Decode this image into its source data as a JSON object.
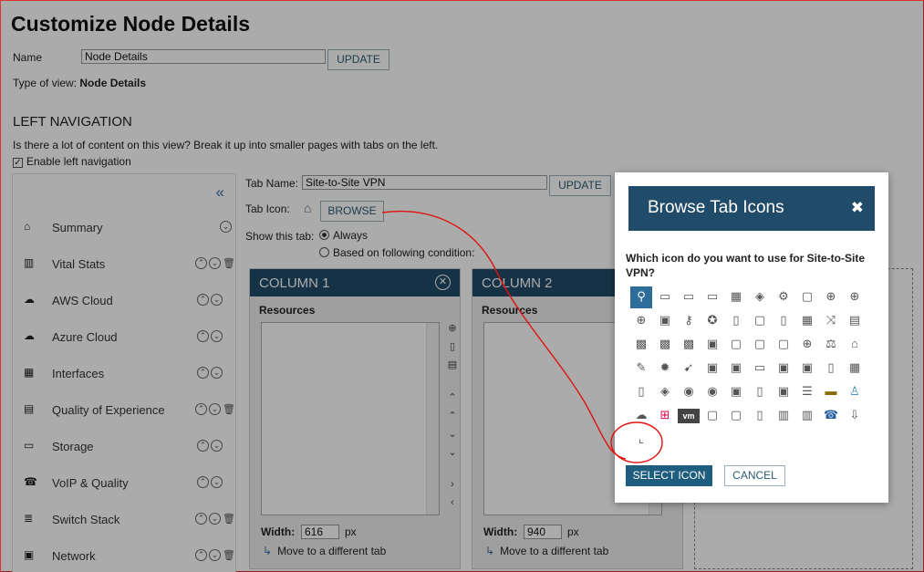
{
  "page": {
    "title": "Customize Node Details",
    "name_label": "Name",
    "name_value": "Node Details",
    "update_label": "UPDATE",
    "type_label": "Type of view:",
    "type_value": "Node Details"
  },
  "left_navigation": {
    "heading": "LEFT NAVIGATION",
    "question": "Is there a lot of content on this view? Break it up into smaller pages with tabs on the left.",
    "enable_label": "Enable left navigation",
    "collapse_glyph": "«",
    "items": [
      {
        "label": "Summary",
        "icon": "home-icon"
      },
      {
        "label": "Vital Stats",
        "icon": "chart-icon"
      },
      {
        "label": "AWS Cloud",
        "icon": "cloud-icon"
      },
      {
        "label": "Azure Cloud",
        "icon": "cloud-icon"
      },
      {
        "label": "Interfaces",
        "icon": "port-icon"
      },
      {
        "label": "Quality of Experience",
        "icon": "qoe-icon"
      },
      {
        "label": "Storage",
        "icon": "storage-icon"
      },
      {
        "label": "VoIP & Quality",
        "icon": "phone-icon"
      },
      {
        "label": "Switch Stack",
        "icon": "stack-icon"
      },
      {
        "label": "Network",
        "icon": "network-icon"
      }
    ]
  },
  "tab_editor": {
    "tab_name_label": "Tab Name:",
    "tab_name_value": "Site-to-Site VPN",
    "update_label": "UPDATE",
    "tab_icon_label": "Tab Icon:",
    "browse_label": "BROWSE",
    "show_label": "Show this tab:",
    "always_label": "Always",
    "condition_label": "Based on following condition:"
  },
  "columns": [
    {
      "title": "COLUMN 1",
      "resources_label": "Resources",
      "width_label": "Width:",
      "width_value": "616",
      "unit": "px",
      "move_label": "Move to a different tab"
    },
    {
      "title": "COLUMN 2",
      "resources_label": "Resources",
      "width_label": "Width:",
      "width_value": "940",
      "unit": "px",
      "move_label": "Move to a different tab"
    }
  ],
  "modal": {
    "title": "Browse Tab Icons",
    "close_glyph": "✖",
    "question": "Which icon do you want to use for Site-to-Site VPN?",
    "select_label": "SELECT ICON",
    "cancel_label": "CANCEL",
    "icons": [
      "vpn-icon",
      "window-icon",
      "window-icon",
      "window-icon",
      "port-icon",
      "layers-icon",
      "device-gear-icon",
      "device-icon",
      "globe-gear-icon",
      "globe-gear-icon",
      "globe-gear-icon",
      "monitor-icon",
      "key-icon",
      "hub-icon",
      "server-icon",
      "device-icon",
      "server-icon",
      "port-icon",
      "shuffle-icon",
      "phone-gear-icon",
      "chip-icon",
      "chip-icon",
      "chip-icon",
      "monitor-icon",
      "device-icon",
      "device-icon",
      "device-icon",
      "plus-icon",
      "balance-icon",
      "home-icon",
      "pencil-icon",
      "gear-icon",
      "arrow-icon",
      "frame-icon",
      "frame-icon",
      "storage-icon",
      "frame-icon",
      "frame-icon",
      "file-icon",
      "grid-icon",
      "file-icon",
      "layers-icon",
      "refresh-icon",
      "refresh-icon",
      "monitor-icon",
      "file-icon",
      "monitor-icon",
      "list-icon",
      "tv-icon",
      "user-icon",
      "cloud-icon",
      "windows-icon",
      "vmware-icon",
      "device-icon",
      "device-icon",
      "file-icon",
      "chart-icon",
      "chart-icon",
      "phone-icon",
      "download-icon",
      "chair-icon"
    ]
  },
  "colors": {
    "accent": "#204b69",
    "button_dark": "#1f5d7f",
    "annotation": "#e0120f"
  }
}
